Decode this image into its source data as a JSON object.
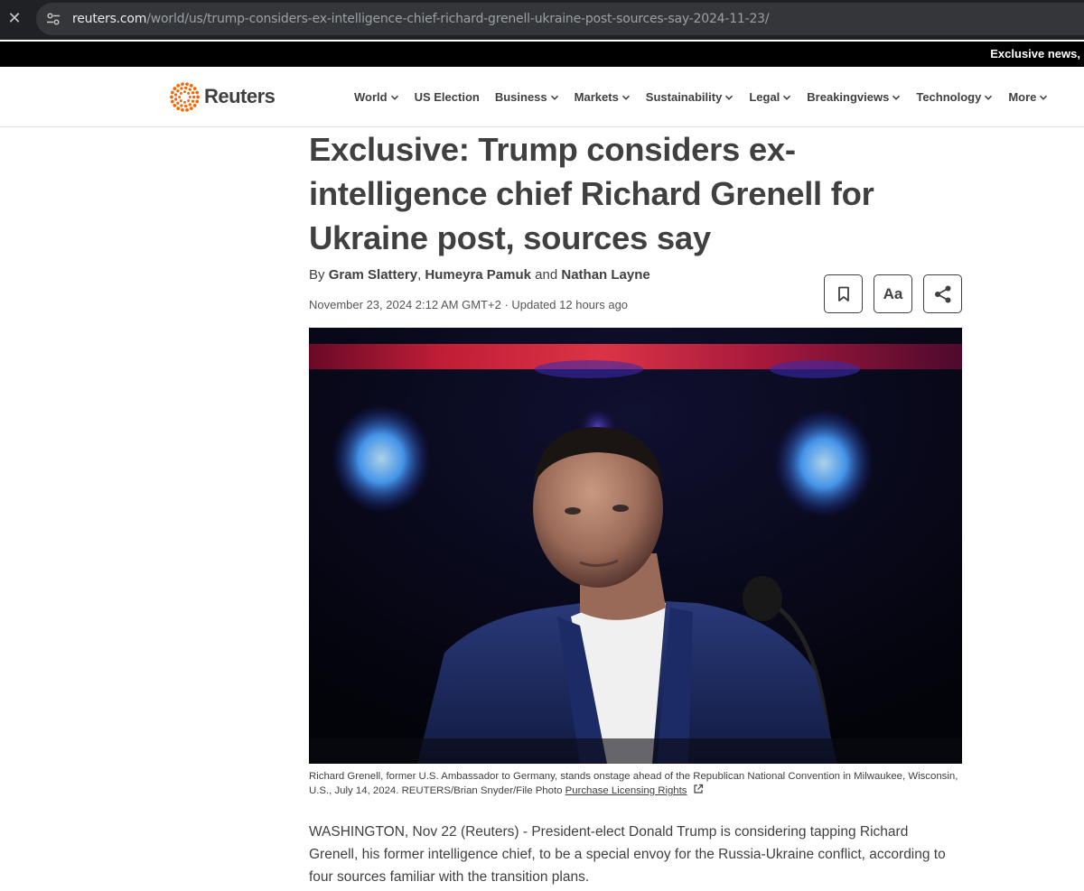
{
  "browser": {
    "url_host": "reuters.com",
    "url_path": "/world/us/trump-considers-ex-intelligence-chief-richard-grenell-ukraine-post-sources-say-2024-11-23/"
  },
  "ticker": {
    "text": "Exclusive news,"
  },
  "header": {
    "logo_text": "Reuters",
    "nav": [
      {
        "label": "World",
        "has_menu": true
      },
      {
        "label": "US Election",
        "has_menu": false
      },
      {
        "label": "Business",
        "has_menu": true
      },
      {
        "label": "Markets",
        "has_menu": true
      },
      {
        "label": "Sustainability",
        "has_menu": true
      },
      {
        "label": "Legal",
        "has_menu": true
      },
      {
        "label": "Breakingviews",
        "has_menu": true
      },
      {
        "label": "Technology",
        "has_menu": true
      },
      {
        "label": "More",
        "has_menu": true
      }
    ]
  },
  "article": {
    "headline": "Exclusive: Trump considers ex-intelligence chief Richard Grenell for Ukraine post, sources say",
    "byline_prefix": "By",
    "authors": [
      "Gram Slattery",
      "Humeyra Pamuk",
      "Nathan Layne"
    ],
    "byline_sep1": ",",
    "byline_sep2": "and",
    "date": "November 23, 2024 2:12 AM GMT+2",
    "updated": "· Updated 12 hours ago",
    "text_size_label": "Aa",
    "caption": "Richard Grenell, former U.S. Ambassador to Germany, stands onstage ahead of the Republican National Convention in Milwaukee, Wisconsin, U.S., July 14, 2024. REUTERS/Brian Snyder/File Photo",
    "caption_link": "Purchase Licensing Rights",
    "body": "WASHINGTON, Nov 22 (Reuters) - President-elect Donald Trump is considering tapping Richard Grenell, his former intelligence chief, to be a special envoy for the Russia-Ukraine conflict, according to four sources familiar with the transition plans."
  },
  "icons": {
    "close": "close-icon",
    "site_settings": "tune-icon",
    "bookmark": "bookmark-icon",
    "share": "share-icon",
    "external": "external-link-icon",
    "chevron": "chevron-down-icon"
  },
  "colors": {
    "brand_orange": "#fa6400",
    "text": "#404040",
    "browser_bg": "#202124",
    "omnibox_bg": "#35363a",
    "ticker_bg": "#000000"
  }
}
